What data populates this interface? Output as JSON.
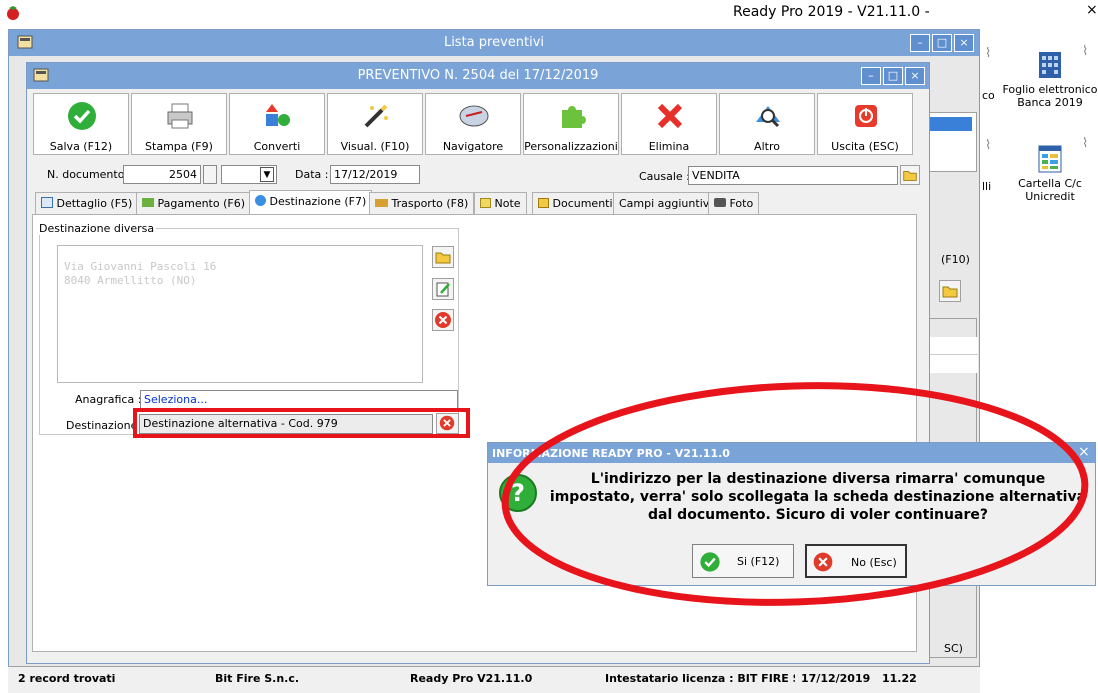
{
  "app": {
    "title": "Ready Pro 2019 - V21.11.0 -"
  },
  "desktop": {
    "icon1": {
      "label_line1": "Foglio elettronico",
      "label_line2": "Banca 2019"
    },
    "icon2": {
      "label_line1": "Cartella C/c",
      "label_line2": "Unicredit"
    },
    "partial1": "co",
    "partial2": "lli"
  },
  "outer_window": {
    "title": "Lista preventivi",
    "partial_f10": "(F10)",
    "partial_sc": "SC)"
  },
  "inner_window": {
    "title": "PREVENTIVO N. 2504 del 17/12/2019"
  },
  "toolbar": {
    "save": "Salva (F12)",
    "print": "Stampa (F9)",
    "convert": "Converti",
    "view": "Visual. (F10)",
    "navigator": "Navigatore",
    "customize": "Personalizzazioni",
    "delete": "Elimina",
    "other": "Altro",
    "exit": "Uscita (ESC)"
  },
  "form": {
    "doc_number_label": "N. documento :",
    "doc_number": "2504",
    "date_label": "Data :",
    "date": "17/12/2019",
    "causale_label": "Causale :",
    "causale": "VENDITA"
  },
  "tabs": [
    {
      "label": "Dettaglio (F5)"
    },
    {
      "label": "Pagamento (F6)"
    },
    {
      "label": "Destinazione (F7)"
    },
    {
      "label": "Trasporto (F8)"
    },
    {
      "label": "Note"
    },
    {
      "label": "Documenti"
    },
    {
      "label": "Campi aggiuntivi"
    },
    {
      "label": "Foto"
    }
  ],
  "destinazione": {
    "group_title": "Destinazione diversa",
    "address_line1": "Via Giovanni Pascoli 16",
    "address_line2": "8040 Armellitto (NO)",
    "anagrafica_label": "Anagrafica :",
    "anagrafica_value": "Seleziona...",
    "destinazione_label": "Destinazione :",
    "destinazione_value": "Destinazione alternativa - Cod. 979"
  },
  "dialog": {
    "title": "INFORMAZIONE READY PRO - V21.11.0",
    "message": "L'indirizzo per la destinazione diversa rimarra' comunque impostato, verra' solo scollegata la scheda destinazione alternativa dal documento. Sicuro di voler continuare?",
    "yes": "Si (F12)",
    "no": "No (Esc)"
  },
  "status": {
    "records": "2 record trovati",
    "company": "Bit Fire S.n.c.",
    "version": "Ready Pro V21.11.0",
    "license": "Intestatario licenza : BIT FIRE SNC",
    "date": "17/12/2019",
    "time": "11.22"
  },
  "colors": {
    "titlebar": "#7aa3d8",
    "highlight_red": "#e8141c",
    "link_blue": "#0033cc"
  }
}
